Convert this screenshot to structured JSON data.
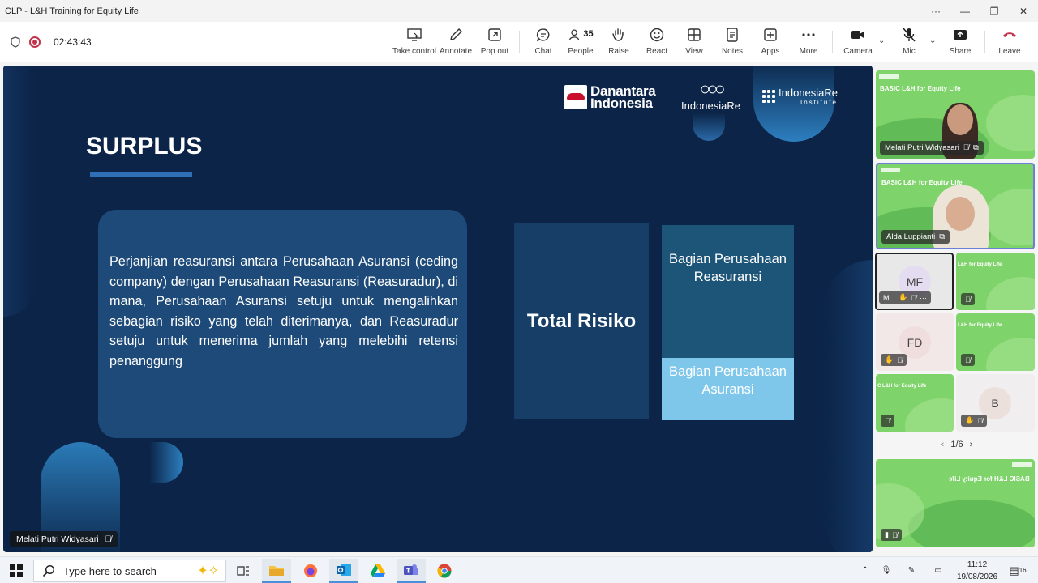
{
  "window": {
    "title": "CLP - L&H Training for Equity Life",
    "controls": [
      "more-options",
      "minimize",
      "restore",
      "close"
    ]
  },
  "meeting": {
    "timer": "02:43:43"
  },
  "toolbar": {
    "take_control": "Take control",
    "annotate": "Annotate",
    "pop_out": "Pop out",
    "chat": "Chat",
    "people": "People",
    "people_count": "35",
    "raise": "Raise",
    "react": "React",
    "view": "View",
    "notes": "Notes",
    "apps": "Apps",
    "more": "More",
    "camera": "Camera",
    "mic": "Mic",
    "share": "Share",
    "leave": "Leave"
  },
  "colors": {
    "slide_bg": "#0b2447",
    "accent_blue": "#2e6fb5",
    "leave_red": "#c4314b",
    "tile_green": "#7ed36a"
  },
  "slide": {
    "logo_danantara_line1": "Danantara",
    "logo_danantara_line2": "Indonesia",
    "logo_indore": "IndonesiaRe",
    "logo_inst": "IndonesiaRe",
    "logo_inst_sub": "Institute",
    "title": "SURPLUS",
    "definition": "Perjanjian reasuransi antara Perusahaan Asuransi (ceding company) dengan Perusahaan Reasuransi (Reasuradur), di mana, Perusahaan Asuransi setuju untuk mengalihkan sebagian risiko yang telah diterimanya, dan Reasuradur setuju untuk menerima jumlah yang melebihi retensi penanggung",
    "total_risk": "Total Risiko",
    "reinsurer_share": "Bagian Perusahaan Reasuransi",
    "insurer_share": "Bagian Perusahaan Asuransi"
  },
  "presenter_tag": "Melati Putri Widyasari",
  "participants": {
    "tile_banner": "BASIC L&H for Equity Life",
    "banner_short": "L&H for Equity Life",
    "banner_short2": "C L&H for Equity Life",
    "p1": "Melati Putri Widyasari",
    "p2": "Alda Luppianti",
    "p3_initials": "MF",
    "p3_name": "M...",
    "p4_initials": "FD",
    "p5_initials": "B",
    "page": "1/6"
  },
  "taskbar": {
    "search_placeholder": "Type here to search",
    "time": "11:12",
    "date": "19/08/2026",
    "notif_count": "16"
  }
}
